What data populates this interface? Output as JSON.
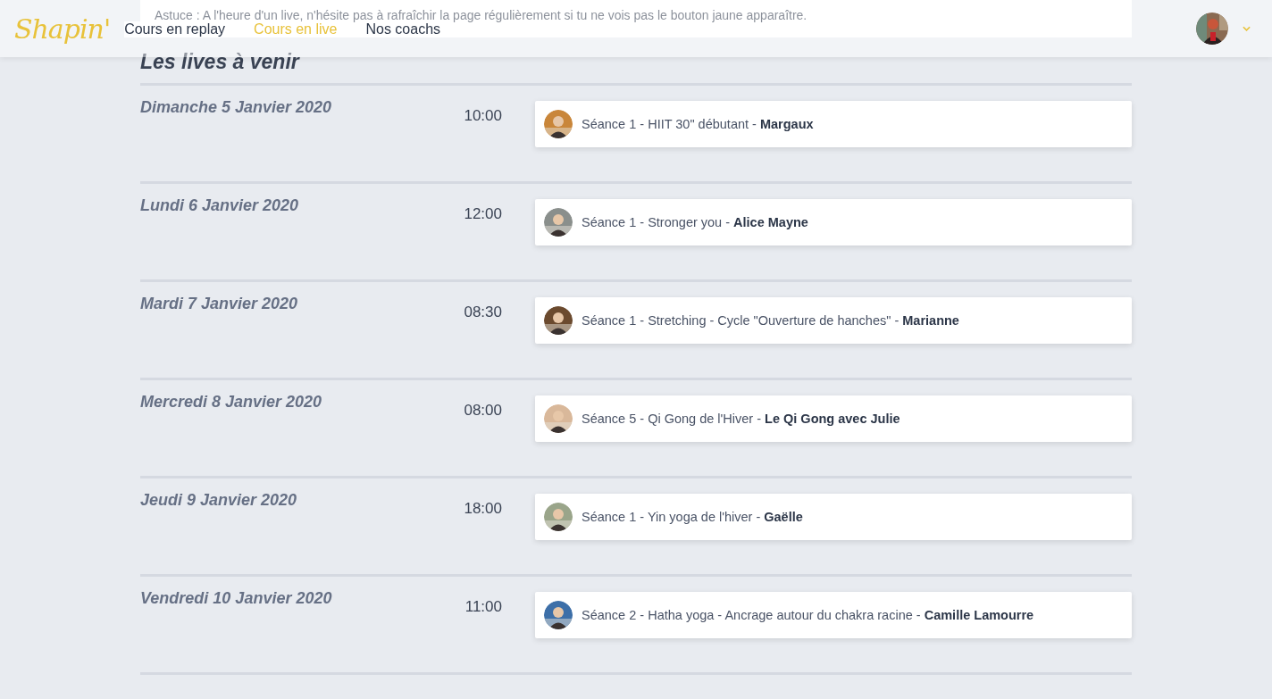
{
  "header": {
    "logo": "Shapin'",
    "nav": [
      {
        "label": "Cours en replay",
        "selected": false
      },
      {
        "label": "Cours en live",
        "selected": true
      },
      {
        "label": "Nos coachs",
        "selected": false
      }
    ]
  },
  "tip": "Astuce : A l'heure d'un live, n'hésite pas à rafraîchir la page régulièrement si tu ne vois pas le bouton jaune apparaître.",
  "section_title": "Les lives à venir",
  "days": [
    {
      "date": "Dimanche 5 Janvier 2020",
      "time": "10:00",
      "session": "Séance 1 - HIIT 30\" débutant - **Margaux**",
      "color": "#c9863a"
    },
    {
      "date": "Lundi 6 Janvier 2020",
      "time": "12:00",
      "session": "Séance 1 - Stronger you - **Alice Mayne**",
      "color": "#8a8f8c"
    },
    {
      "date": "Mardi 7 Janvier 2020",
      "time": "08:30",
      "session": "Séance 1 - Stretching - Cycle \"Ouverture de hanches\" - **Marianne**",
      "color": "#6b4a2e"
    },
    {
      "date": "Mercredi 8 Janvier 2020",
      "time": "08:00",
      "session": "Séance 5 - Qi Gong de l'Hiver - **Le Qi Gong avec Julie**",
      "color": "#d9b89a"
    },
    {
      "date": "Jeudi 9 Janvier 2020",
      "time": "18:00",
      "session": "Séance 1 - Yin yoga de l'hiver - **Gaëlle**",
      "color": "#9aa58a"
    },
    {
      "date": "Vendredi 10 Janvier 2020",
      "time": "11:00",
      "session": "Séance 2 - Hatha yoga - Ancrage autour du chakra racine - **Camille Lamourre**",
      "color": "#3d6fa8"
    }
  ]
}
